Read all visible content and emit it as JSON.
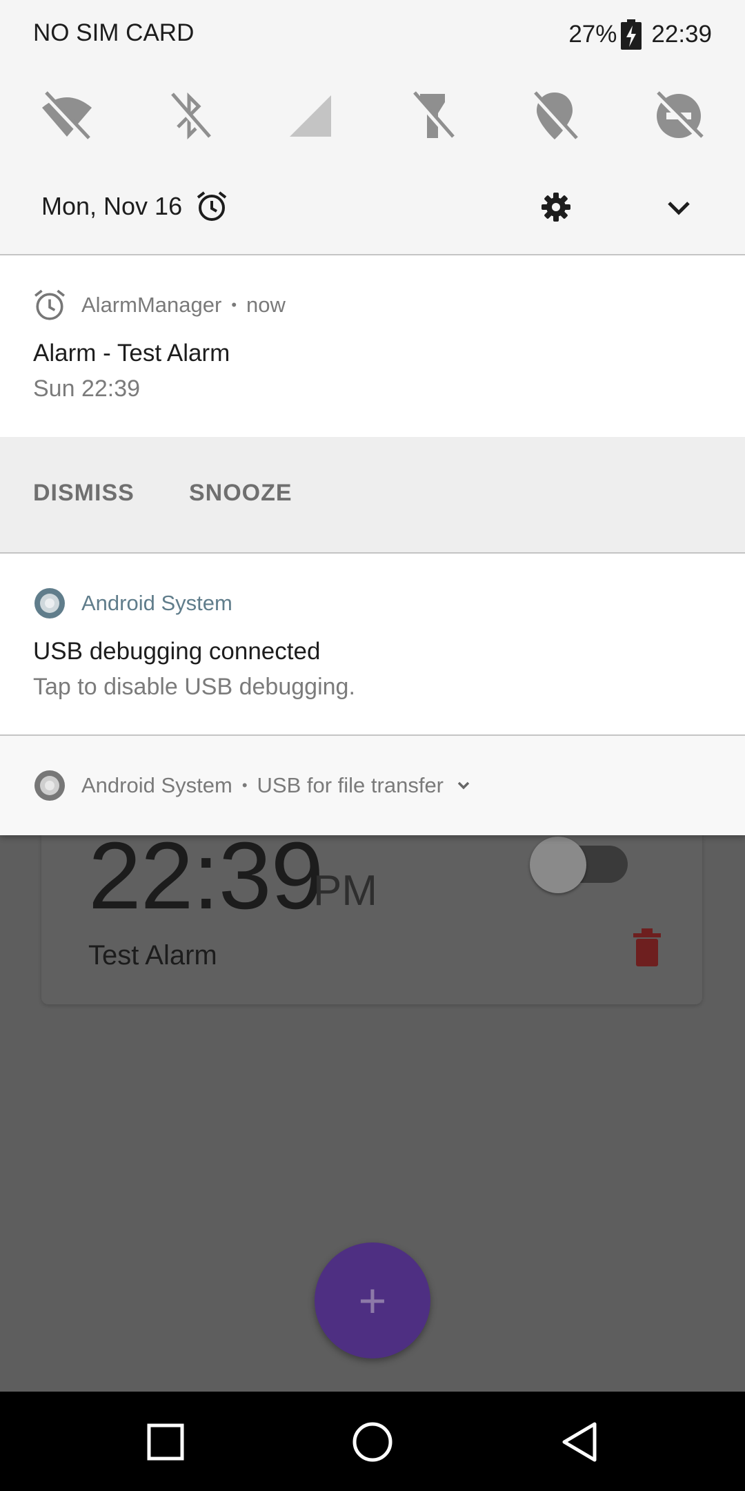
{
  "status_bar": {
    "carrier": "NO SIM CARD",
    "battery": "27%",
    "time": "22:39"
  },
  "quick_settings": {
    "tiles": [
      "wifi-off-icon",
      "bluetooth-off-icon",
      "cellular-icon",
      "flashlight-off-icon",
      "location-off-icon",
      "do-not-disturb-off-icon"
    ],
    "date": "Mon, Nov 16"
  },
  "notifications": [
    {
      "app": "AlarmManager",
      "when": "now",
      "title": "Alarm - Test Alarm",
      "text": "Sun 22:39",
      "actions": [
        "DISMISS",
        "SNOOZE"
      ]
    },
    {
      "app": "Android System",
      "title": "USB debugging connected",
      "text": "Tap to disable USB debugging."
    },
    {
      "app": "Android System",
      "summary": "USB for file transfer"
    }
  ],
  "background_app": {
    "alarm_time": "22:39",
    "alarm_ampm": "PM",
    "alarm_label": "Test Alarm",
    "toggle_on": false,
    "fab_label": "+"
  },
  "colors": {
    "shade_bg": "#f5f5f5",
    "action_bg": "#eeeeee",
    "android_system_blue": "#607d8b",
    "fab": "#4e2f82",
    "trash": "#6e1f1f"
  }
}
